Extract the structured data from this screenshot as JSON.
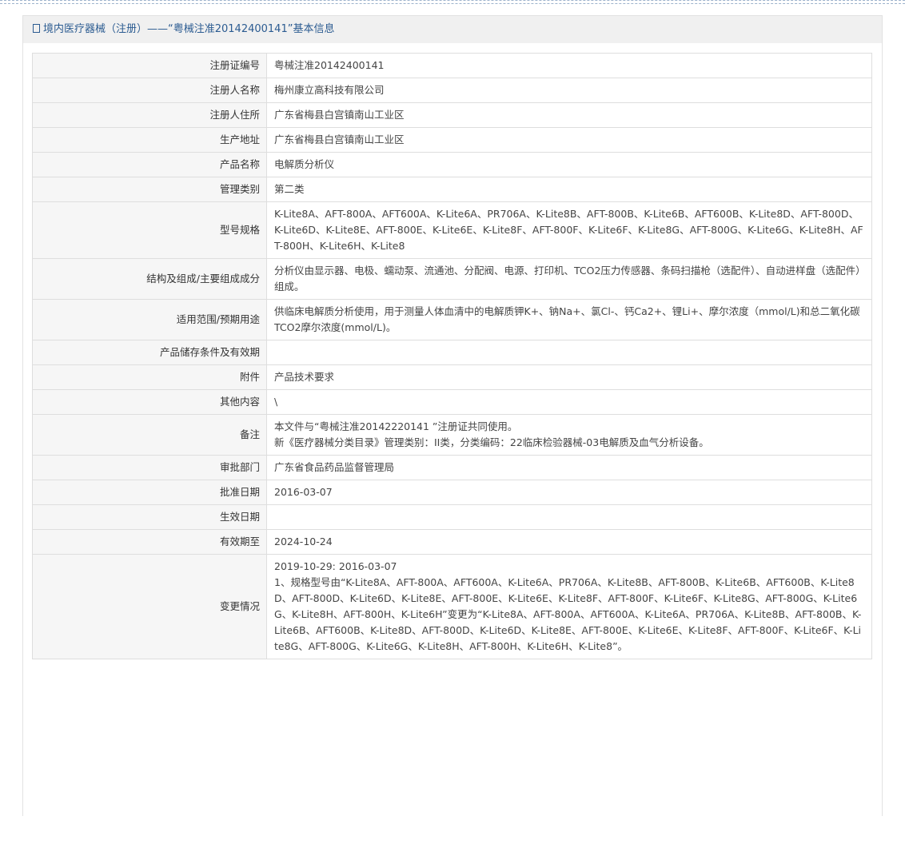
{
  "header": {
    "title": "境内医疗器械（注册）——“粤械注准20142400141”基本信息"
  },
  "rows": [
    {
      "label": "注册证编号",
      "value": "粤械注准20142400141"
    },
    {
      "label": "注册人名称",
      "value": "梅州康立高科技有限公司"
    },
    {
      "label": "注册人住所",
      "value": "广东省梅县白宫镇南山工业区"
    },
    {
      "label": "生产地址",
      "value": "广东省梅县白宫镇南山工业区"
    },
    {
      "label": "产品名称",
      "value": "电解质分析仪"
    },
    {
      "label": "管理类别",
      "value": "第二类"
    },
    {
      "label": "型号规格",
      "value": "K-Lite8A、AFT-800A、AFT600A、K-Lite6A、PR706A、K-Lite8B、AFT-800B、K-Lite6B、AFT600B、K-Lite8D、AFT-800D、K-Lite6D、K-Lite8E、AFT-800E、K-Lite6E、K-Lite8F、AFT-800F、K-Lite6F、K-Lite8G、AFT-800G、K-Lite6G、K-Lite8H、AFT-800H、K-Lite6H、K-Lite8"
    },
    {
      "label": "结构及组成/主要组成成分",
      "value": "分析仪由显示器、电极、蠕动泵、流通池、分配阀、电源、打印机、TCO2压力传感器、条码扫描枪（选配件）、自动进样盘（选配件）组成。"
    },
    {
      "label": "适用范围/预期用途",
      "value": "供临床电解质分析使用，用于测量人体血清中的电解质钾K+、钠Na+、氯Cl-、钙Ca2+、锂Li+、摩尔浓度（mmol/L)和总二氧化碳TCO2摩尔浓度(mmol/L)。"
    },
    {
      "label": "产品储存条件及有效期",
      "value": ""
    },
    {
      "label": "附件",
      "value": "产品技术要求"
    },
    {
      "label": "其他内容",
      "value": "\\"
    },
    {
      "label": "备注",
      "value": "本文件与“粤械注准20142220141 ”注册证共同使用。",
      "value2": "新《医疗器械分类目录》管理类别：II类，分类编码：22临床检验器械-03电解质及血气分析设备。"
    },
    {
      "label": "审批部门",
      "value": "广东省食品药品监督管理局"
    },
    {
      "label": "批准日期",
      "value": "2016-03-07"
    },
    {
      "label": "生效日期",
      "value": ""
    },
    {
      "label": "有效期至",
      "value": "2024-10-24"
    },
    {
      "label": "变更情况",
      "value": "2019-10-29: 2016-03-07",
      "value2": "1、规格型号由“K-Lite8A、AFT-800A、AFT600A、K-Lite6A、PR706A、K-Lite8B、AFT-800B、K-Lite6B、AFT600B、K-Lite8D、AFT-800D、K-Lite6D、K-Lite8E、AFT-800E、K-Lite6E、K-Lite8F、AFT-800F、K-Lite6F、K-Lite8G、AFT-800G、K-Lite6G、K-Lite8H、AFT-800H、K-Lite6H”变更为“K-Lite8A、AFT-800A、AFT600A、K-Lite6A、PR706A、K-Lite8B、AFT-800B、K-Lite6B、AFT600B、K-Lite8D、AFT-800D、K-Lite6D、K-Lite8E、AFT-800E、K-Lite6E、K-Lite8F、AFT-800F、K-Lite6F、K-Lite8G、AFT-800G、K-Lite6G、K-Lite8H、AFT-800H、K-Lite6H、K-Lite8”。"
    }
  ]
}
